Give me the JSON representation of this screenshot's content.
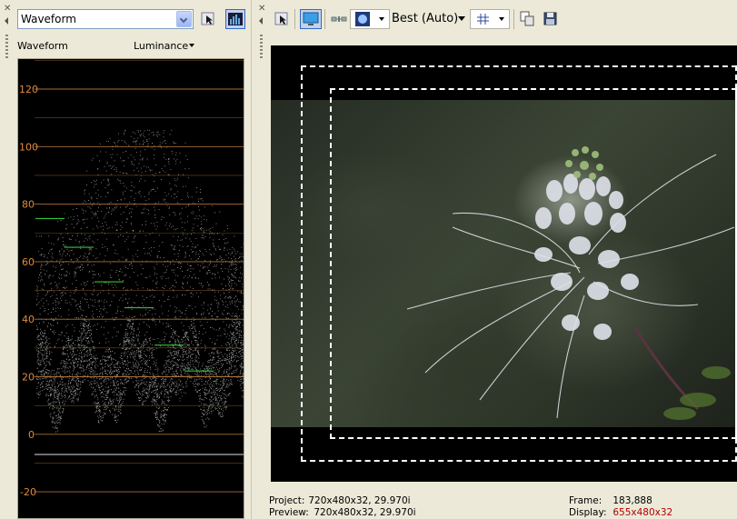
{
  "left_panel": {
    "scope_select": {
      "value": "Waveform"
    },
    "scope_label": "Waveform",
    "channel_select": {
      "value": "Luminance"
    },
    "graticule": {
      "labels": [
        "120",
        "100",
        "80",
        "60",
        "40",
        "20",
        "0",
        "-20"
      ],
      "line_color": "#c8823c",
      "label_color": "#e08a3a",
      "marker_color": "#2fc42f"
    }
  },
  "right_panel": {
    "quality": "Best (Auto)",
    "info": {
      "project_label": "Project:",
      "project_value": "720x480x32, 29.970i",
      "preview_label": "Preview:",
      "preview_value": "720x480x32, 29.970i",
      "frame_label": "Frame:",
      "frame_value": "183,888",
      "display_label": "Display:",
      "display_value": "655x480x32"
    }
  },
  "icons": {
    "close": "close-icon",
    "collapse": "collapse-arrow-icon",
    "pointer": "pointer-icon",
    "graph": "histogram-icon",
    "monitor": "monitor-icon",
    "split": "split-screen-icon",
    "overlay": "overlay-circle-icon",
    "grid": "grid-icon",
    "copy": "copy-snapshot-icon",
    "save": "save-icon"
  }
}
